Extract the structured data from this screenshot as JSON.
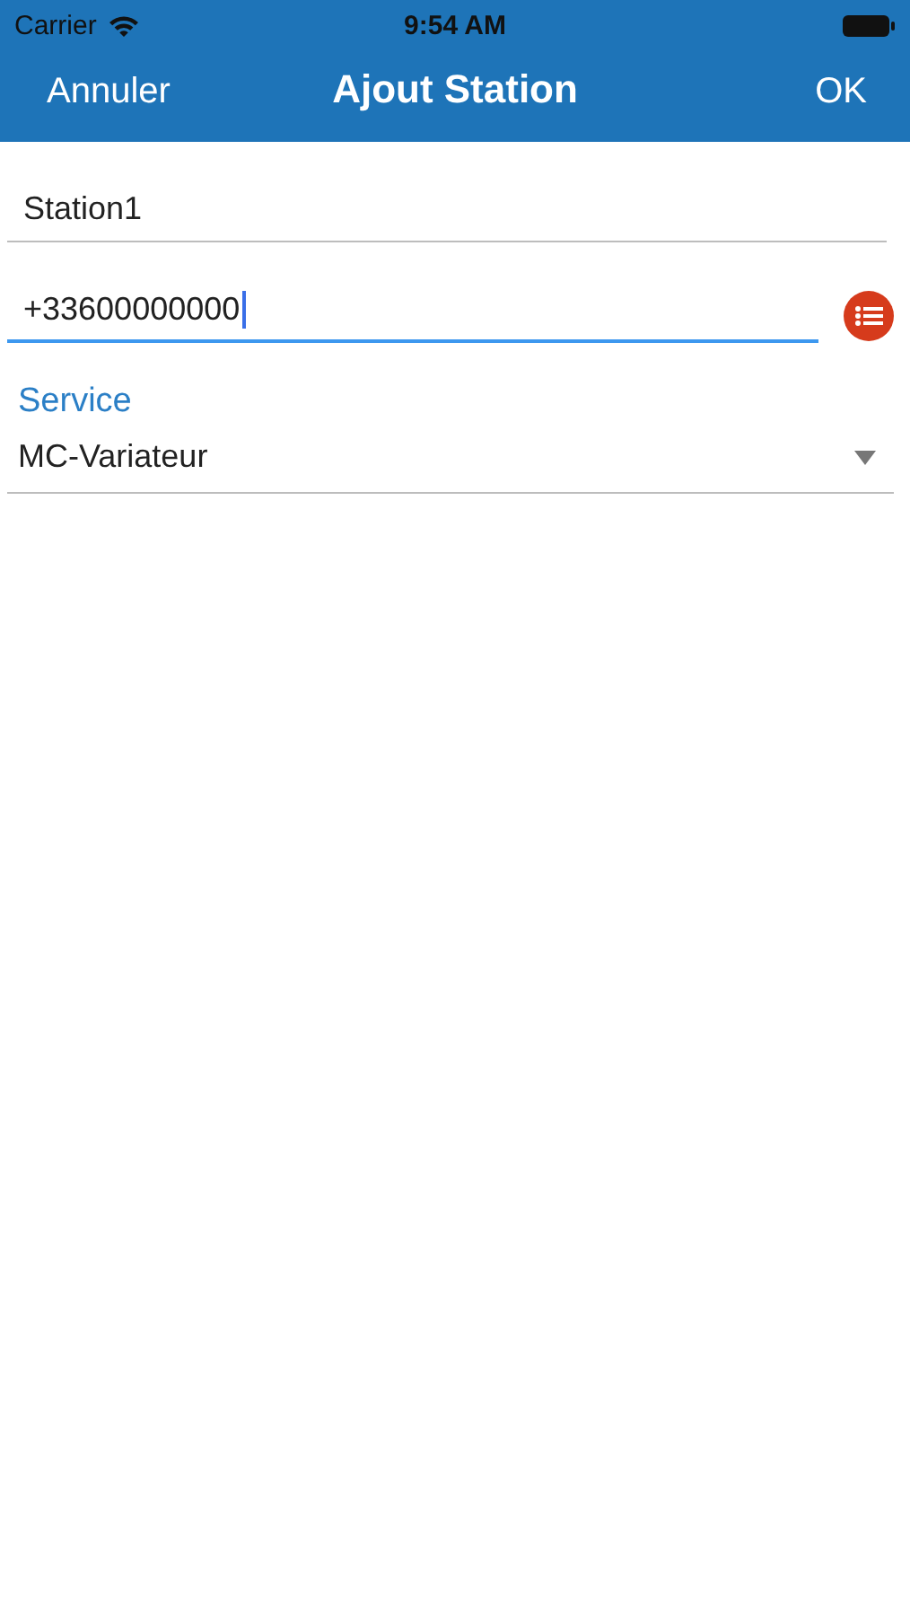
{
  "status_bar": {
    "carrier": "Carrier",
    "time": "9:54 AM"
  },
  "nav_bar": {
    "cancel": "Annuler",
    "title": "Ajout Station",
    "ok": "OK"
  },
  "fields": [
    {
      "value": "Station1",
      "focused": false,
      "has_list_button": false
    },
    {
      "value": "+33600000000",
      "focused": true,
      "has_list_button": true
    }
  ],
  "picker": {
    "label": "Service",
    "value": "MC-Variateur"
  }
}
